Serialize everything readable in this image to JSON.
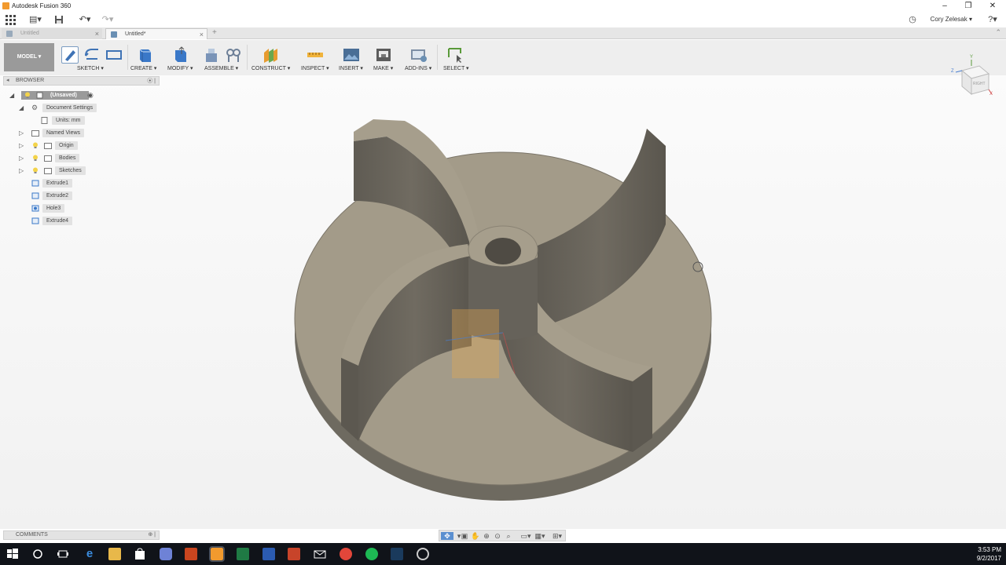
{
  "window": {
    "title": "Autodesk Fusion 360"
  },
  "quick_access": {
    "user": "Cory Zelesak ▾"
  },
  "tabs": [
    {
      "label": "Untitled"
    },
    {
      "label": "Untitled*"
    }
  ],
  "toolbar": {
    "mode": "MODEL ▾",
    "groups": {
      "sketch": "SKETCH ▾",
      "create": "CREATE ▾",
      "modify": "MODIFY ▾",
      "assemble": "ASSEMBLE ▾",
      "construct": "CONSTRUCT ▾",
      "inspect": "INSPECT ▾",
      "insert": "INSERT ▾",
      "make": "MAKE ▾",
      "addins": "ADD-INS ▾",
      "select": "SELECT ▾"
    }
  },
  "browser": {
    "title": "BROWSER",
    "root": "(Unsaved)",
    "document_settings": "Document Settings",
    "units": "Units: mm",
    "named_views": "Named Views",
    "origin": "Origin",
    "bodies": "Bodies",
    "sketches": "Sketches",
    "timeline": [
      "Extrude1",
      "Extrude2",
      "Hole3",
      "Extrude4"
    ]
  },
  "comments": {
    "title": "COMMENTS"
  },
  "viewcube": {
    "face": "RIGHT",
    "axes": [
      "Z",
      "X",
      "Y"
    ]
  },
  "taskbar": {
    "time": "3:53 PM",
    "date": "9/2/2017"
  },
  "colors": {
    "part_face": "#a39b89",
    "part_side": "#6e6a60",
    "toolbar_bg": "#eeeeee",
    "mode_button": "#9a9a9a",
    "taskbar": "#101319"
  }
}
